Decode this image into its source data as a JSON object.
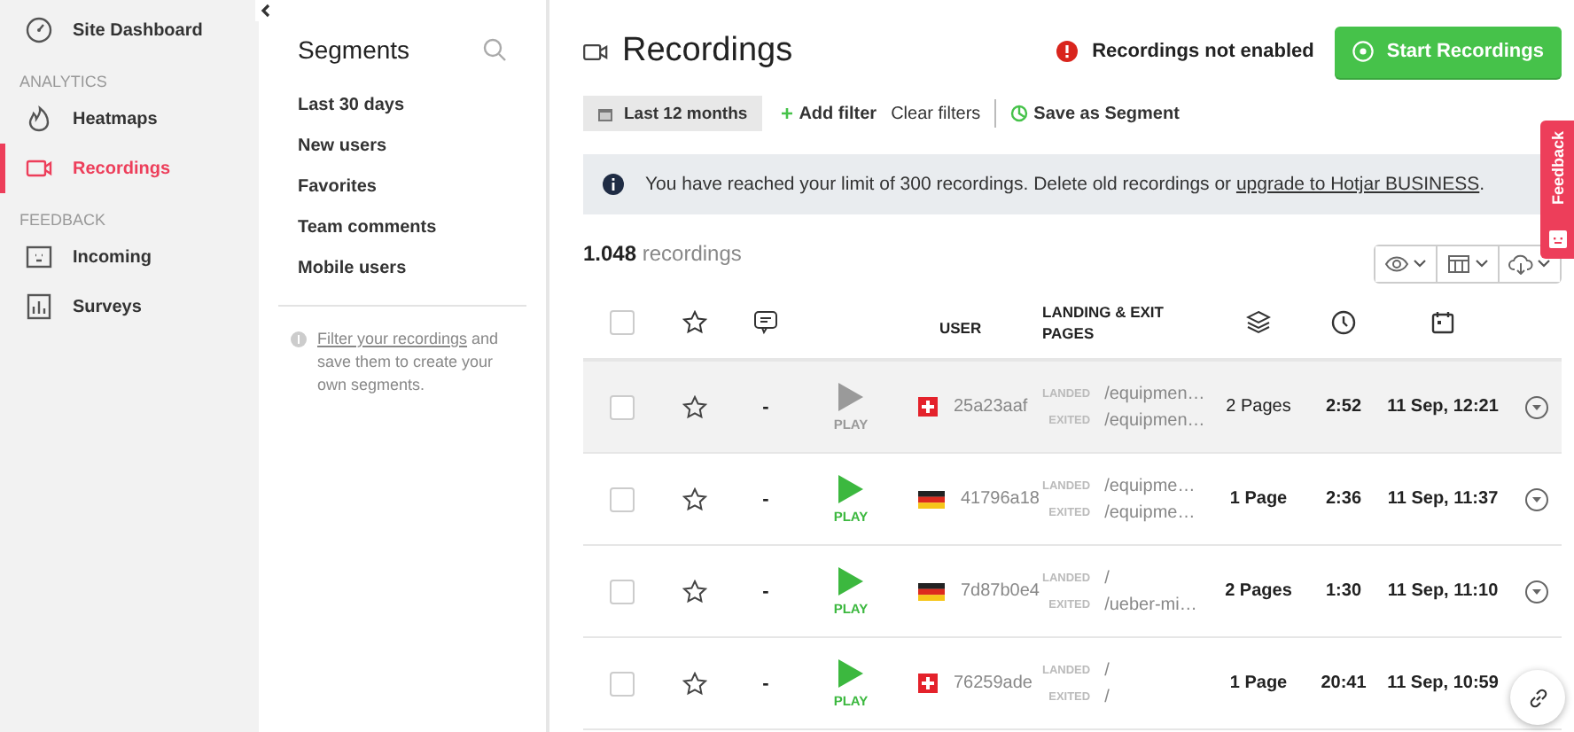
{
  "sidebar": {
    "items": [
      {
        "kind": "link",
        "label": "Site Dashboard",
        "selected": false
      },
      {
        "kind": "heading",
        "label": "ANALYTICS"
      },
      {
        "kind": "link",
        "label": "Heatmaps",
        "selected": false
      },
      {
        "kind": "link",
        "label": "Recordings",
        "selected": true
      },
      {
        "kind": "heading",
        "label": "FEEDBACK"
      },
      {
        "kind": "link",
        "label": "Incoming",
        "selected": false
      },
      {
        "kind": "link",
        "label": "Surveys",
        "selected": false
      }
    ]
  },
  "segments": {
    "title": "Segments",
    "items": [
      "Last 30 days",
      "New users",
      "Favorites",
      "Team comments",
      "Mobile users"
    ],
    "hint_link": "Filter your recordings",
    "hint_text": " and save them to create your own segments."
  },
  "header": {
    "title": "Recordings",
    "status": "Recordings not enabled",
    "start_button": "Start Recordings"
  },
  "filters": {
    "date": "Last 12 months",
    "add_filter": "Add filter",
    "clear": "Clear filters",
    "save": "Save as Segment"
  },
  "banner": {
    "text": "You have reached your limit of 300 recordings. Delete old recordings or ",
    "link": "upgrade to Hotjar BUSINESS",
    "after": "."
  },
  "count": {
    "number": "1.048",
    "label": "recordings"
  },
  "table": {
    "header_checked": false,
    "columns": [
      {
        "kind": "checkbox"
      },
      {
        "kind": "star"
      },
      {
        "kind": "comment"
      },
      {
        "kind": "blank"
      },
      {
        "kind": "text",
        "label": "USER"
      },
      {
        "kind": "text",
        "label": "LANDING & EXIT PAGES"
      },
      {
        "kind": "pages"
      },
      {
        "kind": "duration"
      },
      {
        "kind": "date"
      },
      {
        "kind": "blank"
      }
    ],
    "rows": [
      {
        "highlighted": true,
        "checked": false,
        "starred": false,
        "comments": "-",
        "watched": true,
        "play": "PLAY",
        "flag": {
          "kind": "ch"
        },
        "user": "25a23aaf",
        "landed_label": "LANDED",
        "landed": "/equipmen…",
        "exited_label": "EXITED",
        "exited": "/equipmen…",
        "pages": "2 Pages",
        "duration": "2:52",
        "date": "11 Sep, 12:21",
        "menu": true
      },
      {
        "highlighted": false,
        "checked": false,
        "starred": false,
        "comments": "-",
        "watched": false,
        "play": "PLAY",
        "flag": {
          "kind": "de"
        },
        "user": "41796a18",
        "landed_label": "LANDED",
        "landed": "/equipme…",
        "exited_label": "EXITED",
        "exited": "/equipme…",
        "pages": "1 Page",
        "duration": "2:36",
        "date": "11 Sep, 11:37",
        "menu": true
      },
      {
        "highlighted": false,
        "checked": false,
        "starred": false,
        "comments": "-",
        "watched": false,
        "play": "PLAY",
        "flag": {
          "kind": "de"
        },
        "user": "7d87b0e4",
        "landed_label": "LANDED",
        "landed": "/",
        "exited_label": "EXITED",
        "exited": "/ueber-mi…",
        "pages": "2 Pages",
        "duration": "1:30",
        "date": "11 Sep, 11:10",
        "menu": true
      },
      {
        "highlighted": false,
        "checked": false,
        "starred": false,
        "comments": "-",
        "watched": false,
        "play": "PLAY",
        "flag": {
          "kind": "ch"
        },
        "user": "76259ade",
        "landed_label": "LANDED",
        "landed": "/",
        "exited_label": "EXITED",
        "exited": "/",
        "pages": "1 Page",
        "duration": "20:41",
        "date": "11 Sep, 10:59"
      }
    ]
  },
  "feedback": {
    "label": "Feedback"
  }
}
